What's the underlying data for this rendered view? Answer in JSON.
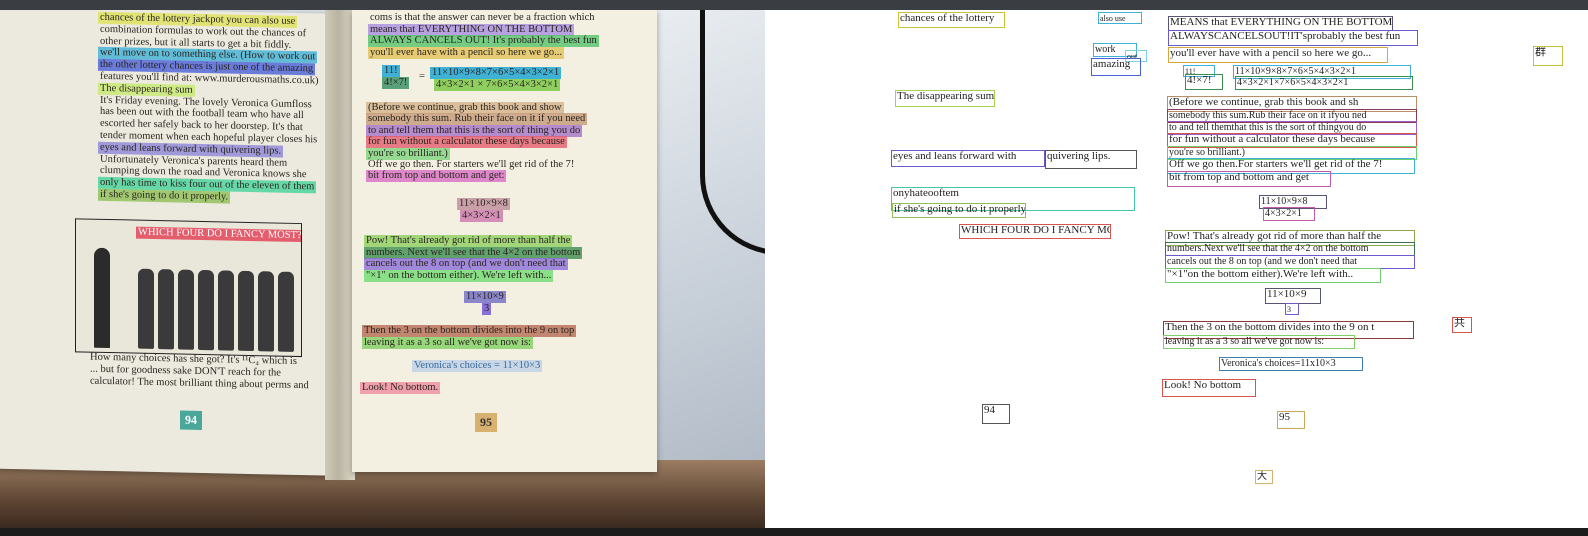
{
  "left_photo": {
    "left_page": {
      "lines": [
        {
          "text": "chances of the lottery jackpot you can also use",
          "color": "#dfe25a"
        },
        {
          "text": "combination formulas to work out the chances of",
          "color": ""
        },
        {
          "text": "other prizes, but it all starts to get a bit fiddly.",
          "color": ""
        },
        {
          "text": "we'll move on to something else. (How to work out",
          "color": "#3fb0d6"
        },
        {
          "text": "the other lottery chances is just one of the amazing",
          "color": "#4a5fd8"
        },
        {
          "text": "features you'll find at: www.murderousmaths.co.uk)",
          "color": ""
        },
        {
          "text": "The disappearing sum",
          "color": "#c7ea6e"
        },
        {
          "text": "It's Friday evening. The lovely Veronica Gumfloss",
          "color": ""
        },
        {
          "text": "has been out with the football team who have all",
          "color": ""
        },
        {
          "text": "escorted her safely back to her doorstep. It's that",
          "color": ""
        },
        {
          "text": "tender moment when each hopeful player closes his",
          "color": ""
        },
        {
          "text": "eyes and leans forward with quivering lips.",
          "color": "#8f86d8"
        },
        {
          "text": "Unfortunately Veronica's parents heard them",
          "color": ""
        },
        {
          "text": "clumping down the road and Veronica knows she",
          "color": ""
        },
        {
          "text": "only has time to kiss four out of the eleven of them",
          "color": "#45d39a"
        },
        {
          "text": "if she's going to do it properly.",
          "color": "#8fbf55"
        }
      ],
      "illustration_caption": "WHICH FOUR DO I FANCY MOST?",
      "after_lines": [
        {
          "text": "How many choices has she got? It's ¹¹C₄ which is",
          "color": ""
        },
        {
          "text": "... but for goodness sake DON'T reach for the",
          "color": ""
        },
        {
          "text": "calculator! The most brilliant thing about perms and",
          "color": ""
        }
      ],
      "page_number": "94"
    },
    "right_page": {
      "lines": [
        {
          "text": "coms is that the answer can never be a fraction which",
          "color": ""
        },
        {
          "text": "means that EVERYTHING ON THE BOTTOM",
          "color": "#a98de0"
        },
        {
          "text": "ALWAYS CANCELS OUT! It's probably the best fun",
          "color": "#53c36a"
        },
        {
          "text": "you'll ever have with a pencil so here we go...",
          "color": "#e2c25a"
        }
      ],
      "fraction_left_top": "11!",
      "fraction_left_bottom": "4!×7!",
      "fraction_eq": "=",
      "fraction_right_top": "11×10×9×8×7×6×5×4×3×2×1",
      "fraction_right_bottom": "4×3×2×1 × 7×6×5×4×3×2×1",
      "para2": [
        {
          "text": "(Before we continue, grab this book and show",
          "color": "#d4b38a"
        },
        {
          "text": "somebody this sum. Rub their face on it if you need",
          "color": "#c49a78"
        },
        {
          "text": "to and tell them that this is the sort of thing you do",
          "color": "#a473c9"
        },
        {
          "text": "for fun without a calculator these days because",
          "color": "#e45d6d"
        },
        {
          "text": "you're so brilliant.)",
          "color": "#7ed47e"
        },
        {
          "text": "Off we go then. For starters we'll get rid of the 7!",
          "color": ""
        },
        {
          "text": "bit from top and bottom and get:",
          "color": "#d86ec5"
        }
      ],
      "f2_top": "11×10×9×8",
      "f2_bottom": "4×3×2×1",
      "para3": [
        {
          "text": "Pow! That's already got rid of more than half the",
          "color": "#8fcf5f"
        },
        {
          "text": "numbers. Next we'll see that the 4×2 on the bottom",
          "color": "#3c8f4f"
        },
        {
          "text": "cancels out the 8 on top (and we don't need that",
          "color": "#8b6fd8"
        },
        {
          "text": "\"×1\" on the bottom either). We're left with...",
          "color": "#6fdc6f"
        }
      ],
      "f3_top": "11×10×9",
      "f3_bottom": "3",
      "para4": [
        {
          "text": "Then the 3 on the bottom divides into the 9 on top",
          "color": "#b56a53"
        },
        {
          "text": "leaving it as a 3 so all we've got now is:",
          "color": "#7fcf62"
        }
      ],
      "result": "Veronica's choices = 11×10×3",
      "look": "Look! No bottom.",
      "page_number": "95"
    }
  },
  "annotations": [
    {
      "text": "chances of the lottery",
      "color": "#c9c23a"
    },
    {
      "text": "also use",
      "color": "#3fb0d6"
    },
    {
      "text": "work",
      "color": "#3fb0d6"
    },
    {
      "text": "out",
      "color": "#7bd2e0"
    },
    {
      "text": "amazing",
      "color": "#4a5fd8"
    },
    {
      "text": "The disappearing sum",
      "color": "#a9cf4e"
    },
    {
      "text": "eyes and leans forward with",
      "color": "#6a5acd"
    },
    {
      "text": "quivering lips.",
      "color": "#555555"
    },
    {
      "text": "onyhateooftem",
      "color": "#45c7a5"
    },
    {
      "text": "if she's going to do it properly.",
      "color": "#8fbf55"
    },
    {
      "text": "WHICH FOUR DO I FANCY MOST?",
      "color": "#d9534f"
    },
    {
      "text": "MEANS that EVERYTHING ON THE BOTTOM",
      "color": "#555577"
    },
    {
      "text": "ALWAYSCANCELSOUT!IT'sprobably the best fun",
      "color": "#6a5acd"
    },
    {
      "text": "you'll ever have with a pencil so here we go...",
      "color": "#d4a83a"
    },
    {
      "text": "11!",
      "color": "#3fb0d6"
    },
    {
      "text": "4!×7!",
      "color": "#3c8f4f"
    },
    {
      "text": "11×10×9×8×7×6×5×4×3×2×1",
      "color": "#3fb0d6"
    },
    {
      "text": "4×3×2×1×7×6×5×4×3×2×1",
      "color": "#3c8f4f"
    },
    {
      "text": "(Before we continue, grab this book and sh",
      "color": "#b89068"
    },
    {
      "text": "somebody this sum.Rub their face on it ifyou ned",
      "color": "#8b3a5a"
    },
    {
      "text": "to and tell themthat this is the sort of thingyou do",
      "color": "#9a5fc0"
    },
    {
      "text": "for fun without a calculator these days because",
      "color": "#d9534f"
    },
    {
      "text": "you're so brilliant.)",
      "color": "#6fcf6f"
    },
    {
      "text": "Off we go then.For starters we'll get rid of the 7!",
      "color": "#3fb0d6"
    },
    {
      "text": "bit from top and bottom and get",
      "color": "#c45aa8"
    },
    {
      "text": "11×10×9×8",
      "color": "#555577"
    },
    {
      "text": "4×3×2×1",
      "color": "#c45aa8"
    },
    {
      "text": "Pow! That's already got rid of more than half the",
      "color": "#8fa84a"
    },
    {
      "text": "numbers.Next we'll see that the 4×2 on the bottom",
      "color": "#3c6f4f"
    },
    {
      "text": "cancels out the 8 on top (and we don't need that",
      "color": "#6a5acd"
    },
    {
      "text": "\"×1\"on the bottom either).We're left with..",
      "color": "#6fcf6f"
    },
    {
      "text": "11×10×9",
      "color": "#555577"
    },
    {
      "text": "3",
      "color": "#6a5acd"
    },
    {
      "text": "Then the 3 on the bottom divides into the 9 on t",
      "color": "#8b3a3a"
    },
    {
      "text": "leaving it as a 3 so all we've got now is:",
      "color": "#7fcf62"
    },
    {
      "text": "Veronica's choices=11x10×3",
      "color": "#3f7fb0"
    },
    {
      "text": "Look! No bottom",
      "color": "#d9534f"
    },
    {
      "text": "94",
      "color": "#555555"
    },
    {
      "text": "95",
      "color": "#c9a85a"
    },
    {
      "text": "共",
      "color": "#d9534f"
    },
    {
      "text": "群",
      "color": "#c9c23a"
    },
    {
      "text": "大",
      "color": "#d4b36a"
    }
  ],
  "colors": {
    "canvas_bg": "#ffffff",
    "page_paper": "#f3f0e2"
  }
}
